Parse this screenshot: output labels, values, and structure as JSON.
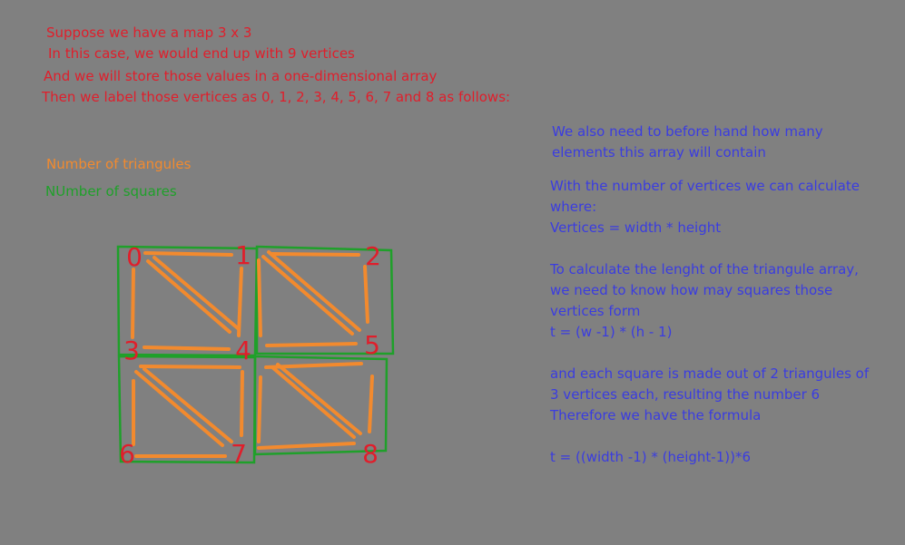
{
  "colors": {
    "background": "#808080",
    "intro": "#e01e2b",
    "triangles": "#f28a2e",
    "squares": "#1fa02a",
    "notes": "#3a3ce0"
  },
  "intro": {
    "line1": "Suppose we have a map 3 x 3",
    "line2": "In this case, we would end up with 9 vertices",
    "line3": "And we will store those values in a one-dimensional array",
    "line4": "Then we label those vertices as 0, 1, 2, 3, 4, 5, 6, 7 and 8 as follows:"
  },
  "legend": {
    "triangles": "Number of triangules",
    "squares": "NUmber of squares"
  },
  "vertex_labels": [
    "0",
    "1",
    "2",
    "3",
    "4",
    "5",
    "6",
    "7",
    "8"
  ],
  "notes": {
    "p1_line1": "We also need to before hand how many",
    "p1_line2": "elements this array will contain",
    "p2_line1": "With  the number of vertices we can calculate",
    "p2_line2": "where:",
    "p2_line3": "Vertices = width * height",
    "p3_line1": "To calculate the lenght of the triangule array,",
    "p3_line2": "we need to know how may squares those",
    "p3_line3": "vertices form",
    "p3_line4": "t = (w -1) * (h - 1)",
    "p4_line1": "and each square is made out of 2 triangules of",
    "p4_line2": "3 vertices each, resulting the number 6",
    "p4_line3": "Therefore we have the formula",
    "p5_line1": "t = ((width -1) * (height-1))*6"
  }
}
